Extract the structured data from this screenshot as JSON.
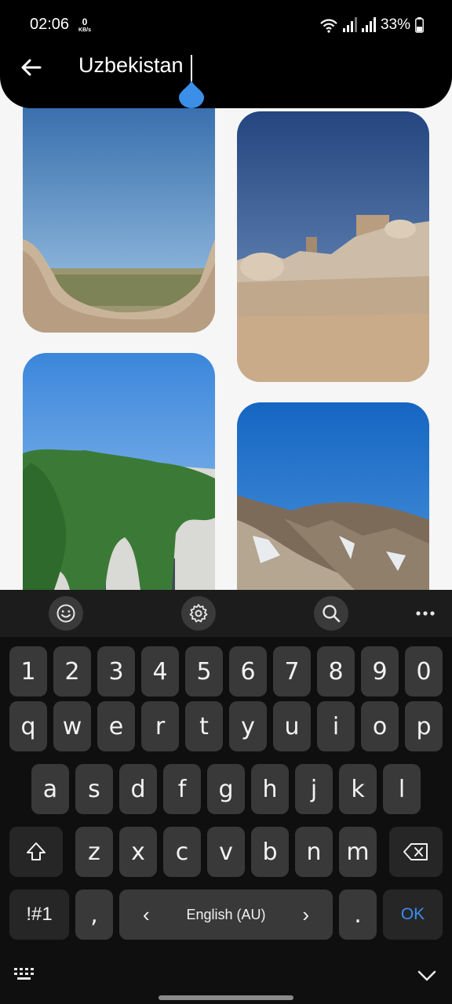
{
  "status_bar": {
    "time": "02:06",
    "net_speed_value": "0",
    "net_speed_unit": "KB/s",
    "battery_percent": "33%",
    "icons": [
      "wifi-icon",
      "signal-icon",
      "signal-icon",
      "battery-icon"
    ]
  },
  "search": {
    "query": "Uzbekistan",
    "back_icon": "arrow-left-icon"
  },
  "results": [
    {
      "name": "desert-fortress-view"
    },
    {
      "name": "khiva-old-city"
    },
    {
      "name": "ivy-covered-building"
    },
    {
      "name": "snowy-mountain"
    }
  ],
  "keyboard": {
    "toolbar": [
      "emoji-icon",
      "settings-icon",
      "search-icon",
      "more-icon"
    ],
    "number_row": [
      "1",
      "2",
      "3",
      "4",
      "5",
      "6",
      "7",
      "8",
      "9",
      "0"
    ],
    "row1": [
      "q",
      "w",
      "e",
      "r",
      "t",
      "y",
      "u",
      "i",
      "o",
      "p"
    ],
    "row2": [
      "a",
      "s",
      "d",
      "f",
      "g",
      "h",
      "j",
      "k",
      "l"
    ],
    "row3": [
      "z",
      "x",
      "c",
      "v",
      "b",
      "n",
      "m"
    ],
    "symbols_label": "!#1",
    "comma_label": ",",
    "space_label": "English (AU)",
    "arrow_left": "‹",
    "arrow_right": "›",
    "period_label": ".",
    "action_label": "OK"
  }
}
